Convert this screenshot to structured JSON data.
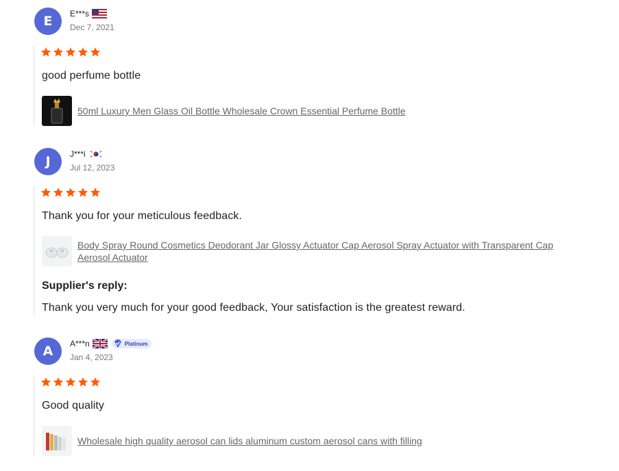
{
  "reviews": [
    {
      "initial": "E",
      "name": "E***s",
      "country_flag": "us-flag",
      "date": "Dec 7, 2021",
      "rating": 5,
      "text": "good perfume bottle",
      "product_title": "50ml Luxury Men Glass Oil Bottle Wholesale Crown Essential Perfume Bottle"
    },
    {
      "initial": "J",
      "name": "J***i",
      "country_flag": "kr-flag",
      "date": "Jul 12, 2023",
      "rating": 5,
      "text": "Thank you for your meticulous feedback.",
      "product_title": "Body Spray Round Cosmetics Deodorant Jar Glossy Actuator Cap Aerosol Spray Actuator with Transparent Cap Aerosol Actuator",
      "supplier_reply_label": "Supplier's reply:",
      "supplier_reply": "Thank you very much for your good feedback, Your satisfaction is the greatest reward."
    },
    {
      "initial": "A",
      "name": "A***n",
      "country_flag": "gb-flag",
      "badge": "Platinum",
      "date": "Jan 4, 2023",
      "rating": 5,
      "text": "Good quality",
      "product_title": "Wholesale high quality aerosol can lids aluminum custom aerosol cans with filling"
    }
  ],
  "colors": {
    "avatar": "#5668d6",
    "star": "#ff5c00",
    "link": "#666666"
  }
}
